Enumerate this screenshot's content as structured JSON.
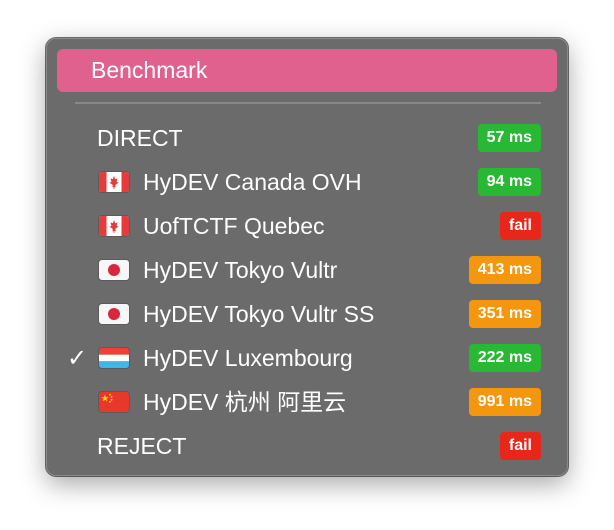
{
  "menu": {
    "header": "Benchmark",
    "items": [
      {
        "label": "DIRECT",
        "flag": null,
        "latency": "57 ms",
        "status": "good",
        "checked": false
      },
      {
        "label": "HyDEV Canada OVH",
        "flag": "canada-flag-icon",
        "latency": "94 ms",
        "status": "good",
        "checked": false
      },
      {
        "label": "UofTCTF Quebec",
        "flag": "canada-flag-icon",
        "latency": "fail",
        "status": "fail",
        "checked": false
      },
      {
        "label": "HyDEV Tokyo Vultr",
        "flag": "japan-flag-icon",
        "latency": "413 ms",
        "status": "slow",
        "checked": false
      },
      {
        "label": "HyDEV Tokyo Vultr SS",
        "flag": "japan-flag-icon",
        "latency": "351 ms",
        "status": "slow",
        "checked": false
      },
      {
        "label": "HyDEV Luxembourg",
        "flag": "luxembourg-flag-icon",
        "latency": "222 ms",
        "status": "good",
        "checked": true
      },
      {
        "label": "HyDEV 杭州 阿里云",
        "flag": "china-flag-icon",
        "latency": "991 ms",
        "status": "slow",
        "checked": false
      },
      {
        "label": "REJECT",
        "flag": null,
        "latency": "fail",
        "status": "fail",
        "checked": false
      }
    ],
    "checkmark": "✓"
  },
  "colors": {
    "menu_bg": "#6b6b6b",
    "header_bg": "#e0618e",
    "badge_good": "#28b834",
    "badge_slow": "#f5960f",
    "badge_fail": "#e8271a"
  }
}
